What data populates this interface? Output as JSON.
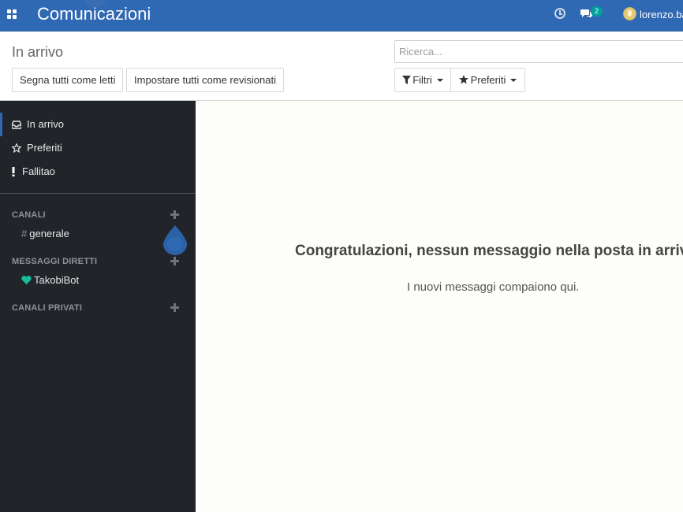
{
  "topbar": {
    "app_title": "Comunicazioni",
    "chat_badge_count": "2",
    "user_name": "lorenzo.ba",
    "colors": {
      "bar": "#2f68b3",
      "badge": "#00a09d"
    },
    "icons": [
      "apps-icon",
      "clock-icon",
      "chat-icon",
      "avatar"
    ]
  },
  "control_panel": {
    "title": "In arrivo",
    "mark_all_read": "Segna tutti come letti",
    "mark_all_reviewed": "Impostare tutti come revisionati",
    "search": {
      "placeholder": "Ricerca...",
      "value": ""
    },
    "filters_label": "Filtri",
    "favorites_label": "Preferiti"
  },
  "sidebar": {
    "items": [
      {
        "label": "In arrivo",
        "icon": "inbox-icon",
        "active": true
      },
      {
        "label": "Preferiti",
        "icon": "star-icon",
        "active": false
      },
      {
        "label": "Fallitao",
        "icon": "exclamation-icon",
        "active": false
      }
    ],
    "sections": {
      "channels": {
        "header": "CANALI",
        "items": [
          {
            "prefix": "#",
            "label": "generale"
          }
        ]
      },
      "direct": {
        "header": "MESSAGGI DIRETTI",
        "items": [
          {
            "label": "TakobiBot",
            "icon": "heart-icon",
            "color": "#1abc9c"
          }
        ]
      },
      "private": {
        "header": "CANALI PRIVATI",
        "items": []
      }
    }
  },
  "main": {
    "empty_title": "Congratulazioni, nessun messaggio nella posta in arrivo",
    "empty_subtitle": "I nuovi messaggi compaiono qui."
  }
}
